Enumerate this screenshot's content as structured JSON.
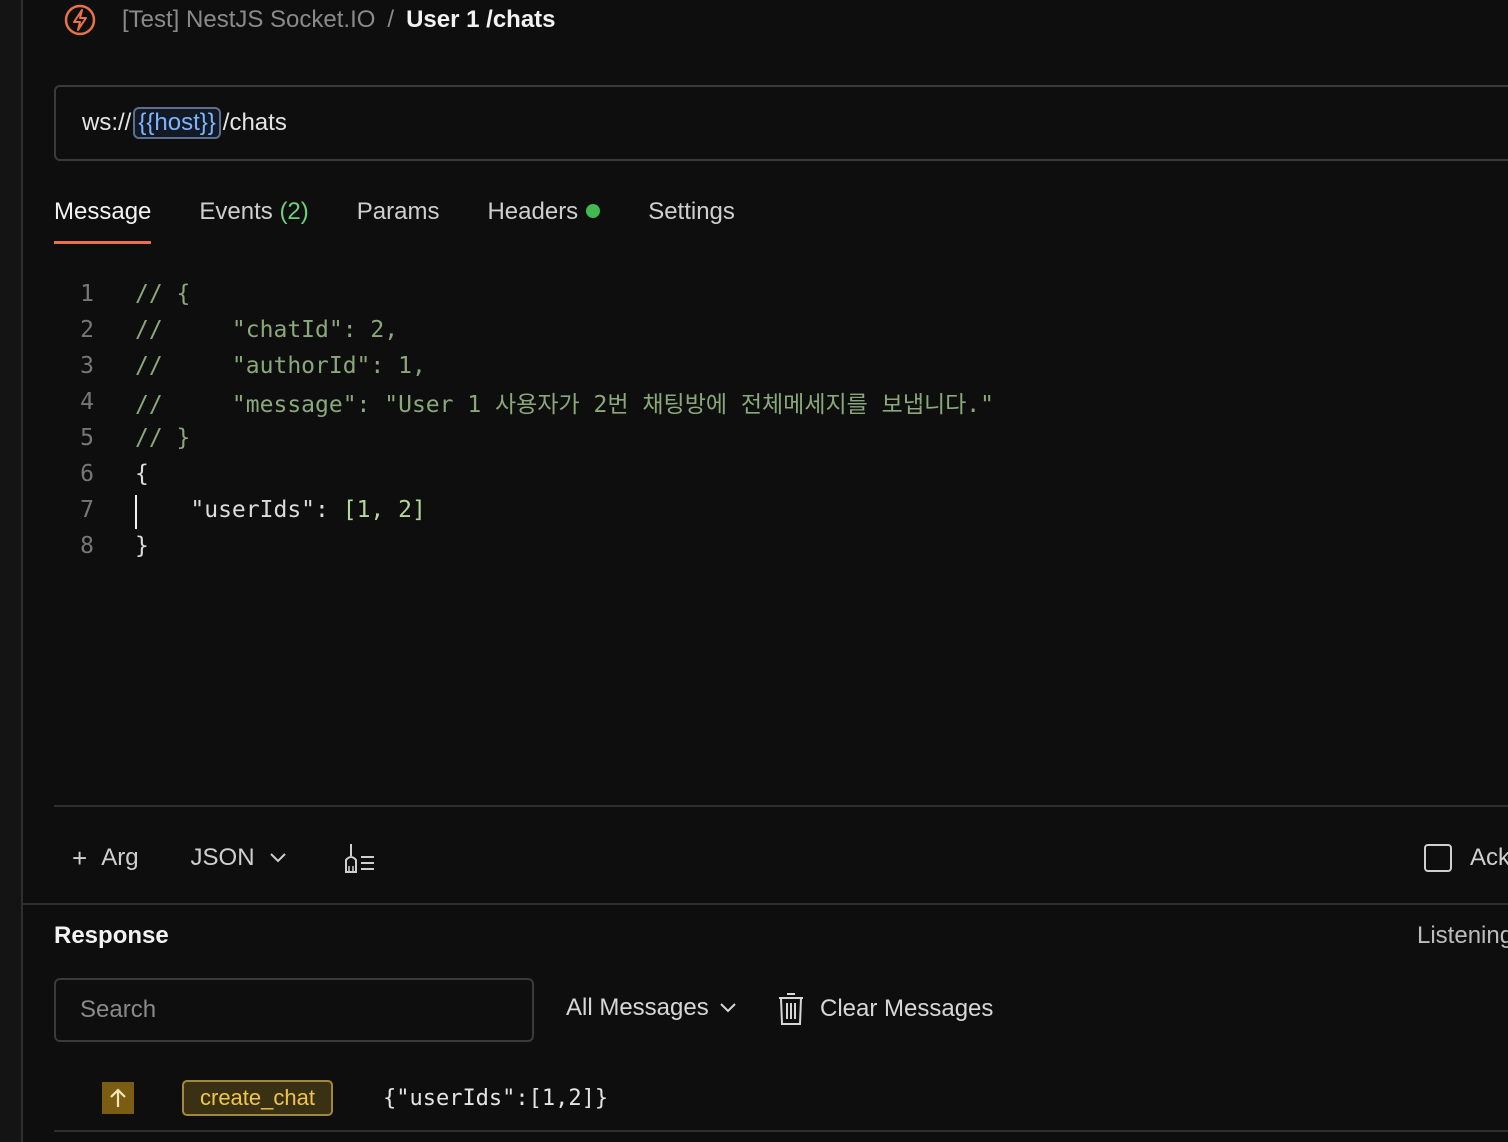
{
  "colors": {
    "accent": "#e8734a",
    "success": "#3fb950",
    "event_chip": "#f0c64a",
    "background": "#0e0e0e"
  },
  "header": {
    "logo_icon": "socketio-logo-icon",
    "collection": "[Test] NestJS Socket.IO",
    "separator": "/",
    "request_name": "User 1 /chats"
  },
  "url": {
    "prefix": "ws://",
    "variable": "{{host}}",
    "suffix": "/chats"
  },
  "tabs": [
    {
      "label": "Message",
      "active": true
    },
    {
      "label": "Events",
      "count": "(2)"
    },
    {
      "label": "Params"
    },
    {
      "label": "Headers",
      "status_dot": true
    },
    {
      "label": "Settings"
    }
  ],
  "editor": {
    "lines": [
      {
        "num": "1",
        "text": "// {"
      },
      {
        "num": "2",
        "text": "//     \"chatId\": 2,"
      },
      {
        "num": "3",
        "text": "//     \"authorId\": 1,"
      },
      {
        "num": "4",
        "text": "//     \"message\": \"User 1 사용자가 2번 채팅방에 전체메세지를 보냅니다.\""
      },
      {
        "num": "5",
        "text": "// }"
      },
      {
        "num": "6",
        "text": "{"
      },
      {
        "num": "7",
        "key": "\"userIds\": ",
        "value": "[1, 2]"
      },
      {
        "num": "8",
        "text": "}"
      }
    ]
  },
  "toolbar": {
    "add_arg": "Arg",
    "format": "JSON",
    "ack_label": "Ack"
  },
  "response": {
    "title": "Response",
    "status": "Listening",
    "search_placeholder": "Search",
    "filter": "All Messages",
    "clear_label": "Clear Messages",
    "messages": [
      {
        "direction": "outgoing",
        "event": "create_chat",
        "payload": "{\"userIds\":[1,2]}"
      }
    ]
  }
}
